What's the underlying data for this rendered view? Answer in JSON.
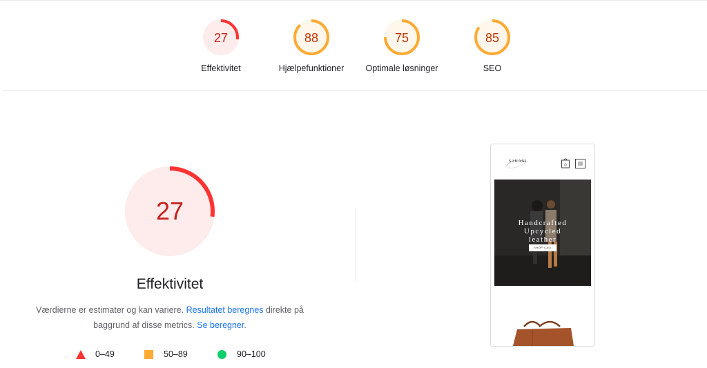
{
  "colors": {
    "fail": "#ff3333",
    "fail_bg": "#fdeceb",
    "fail_text": "#c7221f",
    "average": "#ffaa33",
    "average_bg": "#fff7eb",
    "average_text": "#c33300",
    "pass": "#0cce6b",
    "link": "#1a73e8"
  },
  "summary": {
    "gauges": [
      {
        "label": "Effektivitet",
        "score": "27",
        "value": 27,
        "rating": "fail"
      },
      {
        "label": "Hjælpefunktioner",
        "score": "88",
        "value": 88,
        "rating": "average"
      },
      {
        "label": "Optimale løsninger",
        "score": "75",
        "value": 75,
        "rating": "average"
      },
      {
        "label": "SEO",
        "score": "85",
        "value": 85,
        "rating": "average"
      }
    ]
  },
  "category": {
    "score": "27",
    "value": 27,
    "title": "Effektivitet",
    "desc_before": "Værdierne er estimater og kan variere. ",
    "desc_link1": "Resultatet beregnes",
    "desc_middle": " direkte på baggrund af disse metrics. ",
    "desc_link2": "Se beregner",
    "desc_after": "."
  },
  "legend": [
    {
      "icon": "triangle-icon",
      "range": "0–49"
    },
    {
      "icon": "square-icon",
      "range": "50–89"
    },
    {
      "icon": "circle-icon",
      "range": "90–100"
    }
  ],
  "screenshot": {
    "logo": "SAKANJ",
    "cart_count": "0",
    "hero_title_1": "Handcrafted",
    "hero_title_2": "Upcycled",
    "hero_title_3": "leather",
    "hero_button": "SHOP CALI"
  }
}
